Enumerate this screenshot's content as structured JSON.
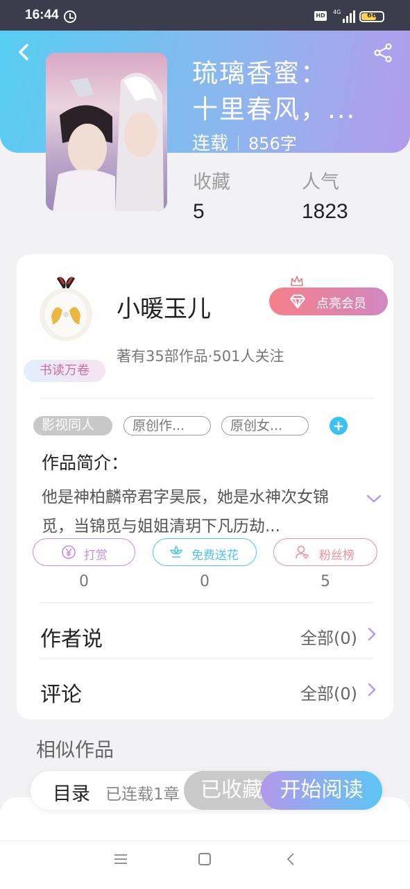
{
  "status_bar": {
    "time": "16:44",
    "network": "4G",
    "hd": "HD",
    "battery_percent": 66,
    "battery_label": "66"
  },
  "book": {
    "title_line1": "琉璃香蜜：",
    "title_line2": "十里春风，...",
    "status": "连载",
    "word_count": "856字",
    "stats": [
      {
        "label": "收藏",
        "value": "5"
      },
      {
        "label": "人气",
        "value": "1823"
      }
    ]
  },
  "author": {
    "name": "小暖玉儿",
    "badge": "书读万卷",
    "meta": "著有35部作品·501人关注",
    "vip_label": "点亮会员"
  },
  "tags": {
    "items": [
      "影视同人",
      "原创作...",
      "原创女..."
    ],
    "add_symbol": "+"
  },
  "intro": {
    "title": "作品简介：",
    "text": "他是神柏麟帝君字昊辰，她是水神次女锦觅，当锦觅与姐姐清玥下凡历劫..."
  },
  "actions": [
    {
      "label": "打赏",
      "count": "0",
      "color": "#c58fe0"
    },
    {
      "label": "免费送花",
      "count": "0",
      "color": "#4cc6ec"
    },
    {
      "label": "粉丝榜",
      "count": "5",
      "color": "#ef8f96"
    }
  ],
  "rows": [
    {
      "label": "作者说",
      "value": "全部(0)"
    },
    {
      "label": "评论",
      "value": "全部(0)"
    }
  ],
  "similar": {
    "title": "相似作品"
  },
  "bottom_bar": {
    "toc_label": "目录",
    "toc_progress": "已连载1章",
    "fav_label": "已收藏",
    "read_label": "开始阅读"
  },
  "icons": {
    "back": "back-arrow-icon",
    "share": "share-icon",
    "crown": "crown-icon",
    "diamond": "diamond-icon",
    "yen": "yen-coin-icon",
    "flower": "flower-icon",
    "fan": "user-heart-icon",
    "expand": "chevron-down-icon",
    "arrow": "chevron-right-icon"
  },
  "colors": {
    "accent_purple": "#b398ec",
    "accent_blue": "#5cc6f2",
    "header_start": "#57cdf3",
    "header_end": "#b39ceb"
  }
}
